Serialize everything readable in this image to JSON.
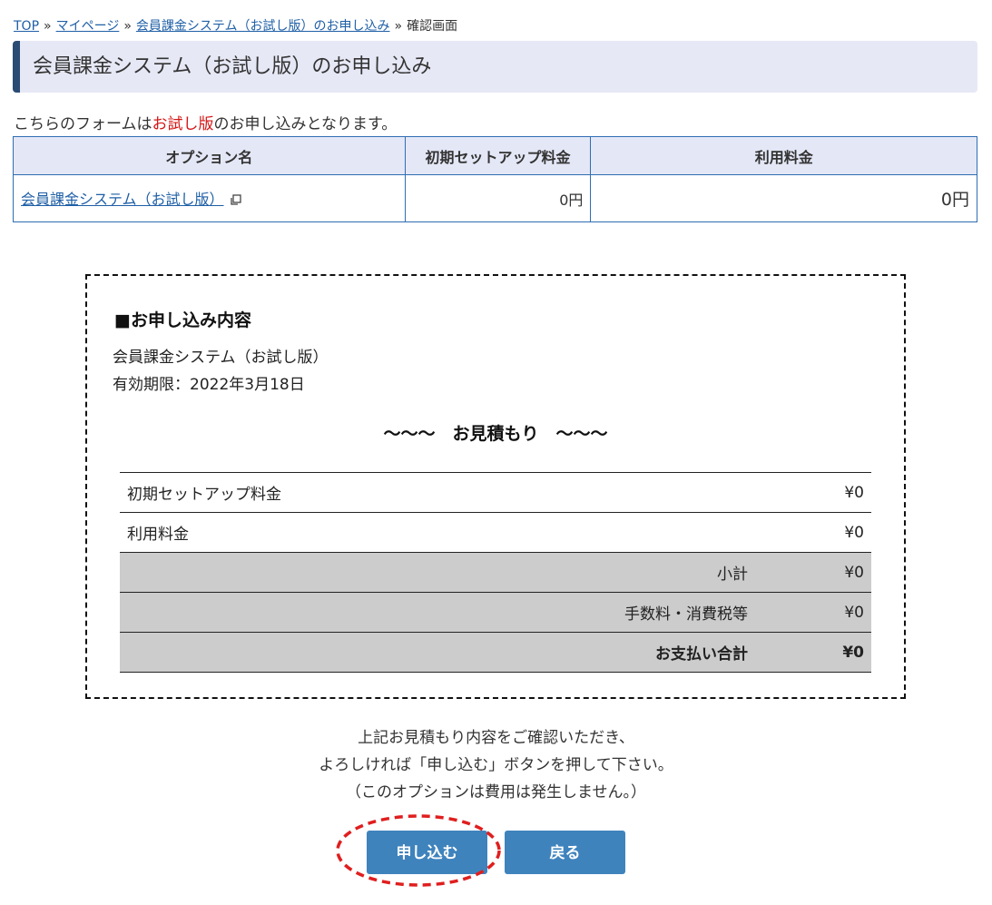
{
  "breadcrumb": {
    "items": [
      {
        "label": "TOP"
      },
      {
        "label": "マイページ"
      },
      {
        "label": "会員課金システム（お試し版）のお申し込み"
      },
      {
        "label": "確認画面"
      }
    ],
    "separator": "»"
  },
  "page_title": "会員課金システム（お試し版）のお申し込み",
  "intro": {
    "prefix": "こちらのフォームは",
    "highlight": "お試し版",
    "suffix": "のお申し込みとなります。"
  },
  "options_table": {
    "headers": [
      "オプション名",
      "初期セットアップ料金",
      "利用料金"
    ],
    "rows": [
      {
        "name": "会員課金システム（お試し版）",
        "setup_fee": "0円",
        "usage_fee": "0円"
      }
    ]
  },
  "quote": {
    "heading": "■お申し込み内容",
    "item_name": "会員課金システム（お試し版）",
    "expiry": "有効期限：2022年3月18日",
    "estimate_title": "〜〜〜　お見積もり　〜〜〜",
    "rows": [
      {
        "label": "初期セットアップ料金",
        "value": "¥0"
      },
      {
        "label": "利用料金",
        "value": "¥0"
      },
      {
        "label": "小計",
        "value": "¥0"
      },
      {
        "label": "手数料・消費税等",
        "value": "¥0"
      },
      {
        "label": "お支払い合計",
        "value": "¥0"
      }
    ]
  },
  "notice": {
    "line1": "上記お見積もり内容をご確認いただき、",
    "line2": "よろしければ「申し込む」ボタンを押して下さい。",
    "line3": "（このオプションは費用は発生しません。）"
  },
  "buttons": {
    "apply_label": "申し込む",
    "back_label": "戻る"
  },
  "colors": {
    "link": "#1f5fa6",
    "title_bar_bg": "#e6e8f5",
    "title_accent": "#2a4b73",
    "table_border": "#2f6eb3",
    "highlight_text": "#d31515",
    "button_bg": "#3f83bd",
    "annotation_ring": "#e01e1e"
  }
}
